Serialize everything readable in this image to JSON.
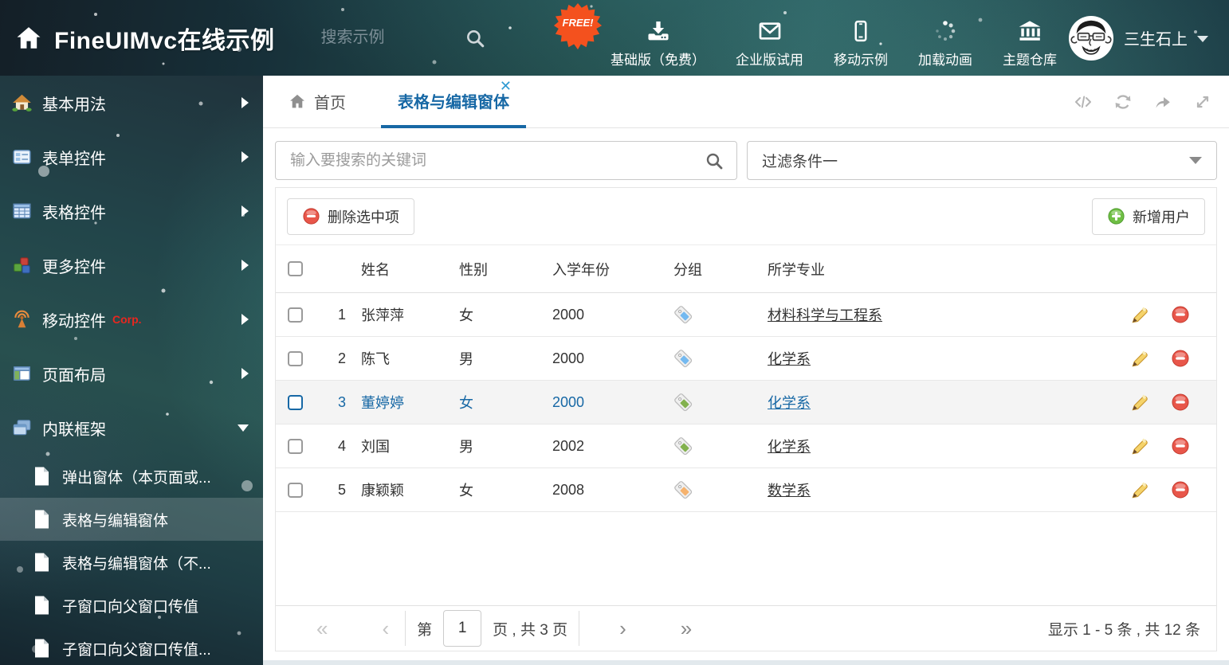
{
  "header": {
    "title": "FineUIMvc在线示例",
    "search_placeholder": "搜索示例",
    "free_badge": "FREE!",
    "nav_items": [
      {
        "label": "基础版（免费）"
      },
      {
        "label": "企业版试用"
      },
      {
        "label": "移动示例"
      },
      {
        "label": "加载动画"
      },
      {
        "label": "主题仓库"
      }
    ],
    "user_name": "三生石上"
  },
  "sidebar": {
    "items": [
      {
        "label": "基本用法"
      },
      {
        "label": "表单控件"
      },
      {
        "label": "表格控件"
      },
      {
        "label": "更多控件"
      },
      {
        "label": "移动控件",
        "badge": "Corp."
      },
      {
        "label": "页面布局"
      },
      {
        "label": "内联框架",
        "expanded": true
      }
    ],
    "subitems": [
      {
        "label": "弹出窗体（本页面或..."
      },
      {
        "label": "表格与编辑窗体",
        "selected": true
      },
      {
        "label": "表格与编辑窗体（不..."
      },
      {
        "label": "子窗口向父窗口传值"
      },
      {
        "label": "子窗口向父窗口传值..."
      }
    ]
  },
  "tabs": {
    "home": "首页",
    "active": "表格与编辑窗体"
  },
  "filter_bar": {
    "search_placeholder": "输入要搜索的关键词",
    "filter_value": "过滤条件一"
  },
  "grid": {
    "delete_button": "删除选中项",
    "add_button": "新增用户",
    "columns": [
      "姓名",
      "性别",
      "入学年份",
      "分组",
      "所学专业"
    ],
    "rows": [
      {
        "num": "1",
        "name": "张萍萍",
        "gender": "女",
        "year": "2000",
        "tag_color": "#74b9f0",
        "major": "材料科学与工程系",
        "selected": false
      },
      {
        "num": "2",
        "name": "陈飞",
        "gender": "男",
        "year": "2000",
        "tag_color": "#74b9f0",
        "major": "化学系",
        "selected": false
      },
      {
        "num": "3",
        "name": "董婷婷",
        "gender": "女",
        "year": "2000",
        "tag_color": "#82b14e",
        "major": "化学系",
        "selected": true
      },
      {
        "num": "4",
        "name": "刘国",
        "gender": "男",
        "year": "2002",
        "tag_color": "#82b14e",
        "major": "化学系",
        "selected": false
      },
      {
        "num": "5",
        "name": "康颖颖",
        "gender": "女",
        "year": "2008",
        "tag_color": "#f6b26d",
        "major": "数学系",
        "selected": false
      }
    ]
  },
  "pagination": {
    "first": "«",
    "prev": "‹",
    "next": "›",
    "last": "»",
    "page_prefix": "第",
    "current_page": "1",
    "page_suffix": "页 , 共 3 页",
    "summary": "显示 1 - 5 条 , 共 12 条"
  },
  "colors": {
    "accent_blue": "#1768a5",
    "free_badge_orange": "#f4511e",
    "delete_red": "#e8564a",
    "add_green": "#6fbf44",
    "corp_badge_red": "#e8271f"
  }
}
